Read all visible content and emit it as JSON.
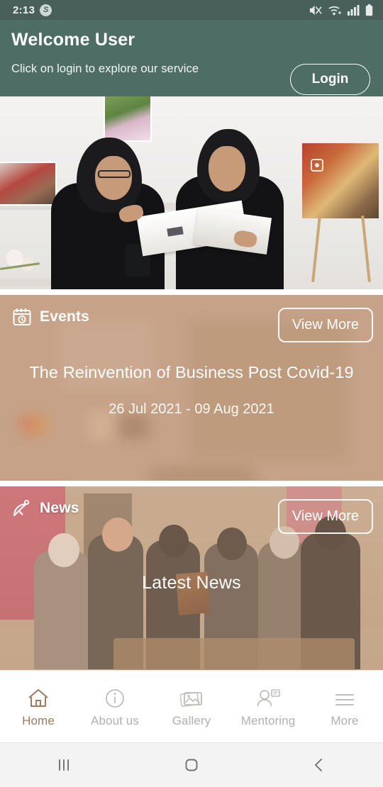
{
  "statusbar": {
    "time": "2:13",
    "app_badge": "S",
    "icons": [
      "mute-icon",
      "wifi-icon",
      "signal-icon",
      "battery-icon"
    ]
  },
  "header": {
    "title": "Welcome User",
    "subtitle": "Click on login to explore our service",
    "login_label": "Login",
    "background_color": "#4e6d65"
  },
  "hero": {
    "alt": "Two women in black abayas reviewing a photo album in a studio"
  },
  "events": {
    "icon": "calendar-icon",
    "section_label": "Events",
    "view_more_label": "View More",
    "title": "The Reinvention of Business Post Covid-19",
    "date_range": "26 Jul 2021 - 09 Aug 2021",
    "background_color": "#c6a288"
  },
  "news": {
    "icon": "satellite-dish-icon",
    "section_label": "News",
    "view_more_label": "View More",
    "title": "Latest News",
    "background_color": "#c8a58a"
  },
  "tabbar": {
    "active_color": "#9b7c5f",
    "inactive_color": "#b3b0ad",
    "items": [
      {
        "label": "Home",
        "icon": "home-icon",
        "active": true
      },
      {
        "label": "About us",
        "icon": "info-icon",
        "active": false
      },
      {
        "label": "Gallery",
        "icon": "gallery-icon",
        "active": false
      },
      {
        "label": "Mentoring",
        "icon": "mentoring-icon",
        "active": false
      },
      {
        "label": "More",
        "icon": "menu-icon",
        "active": false
      }
    ]
  },
  "system_nav": {
    "recents": "recents-icon",
    "home": "home-button-icon",
    "back": "back-icon"
  }
}
